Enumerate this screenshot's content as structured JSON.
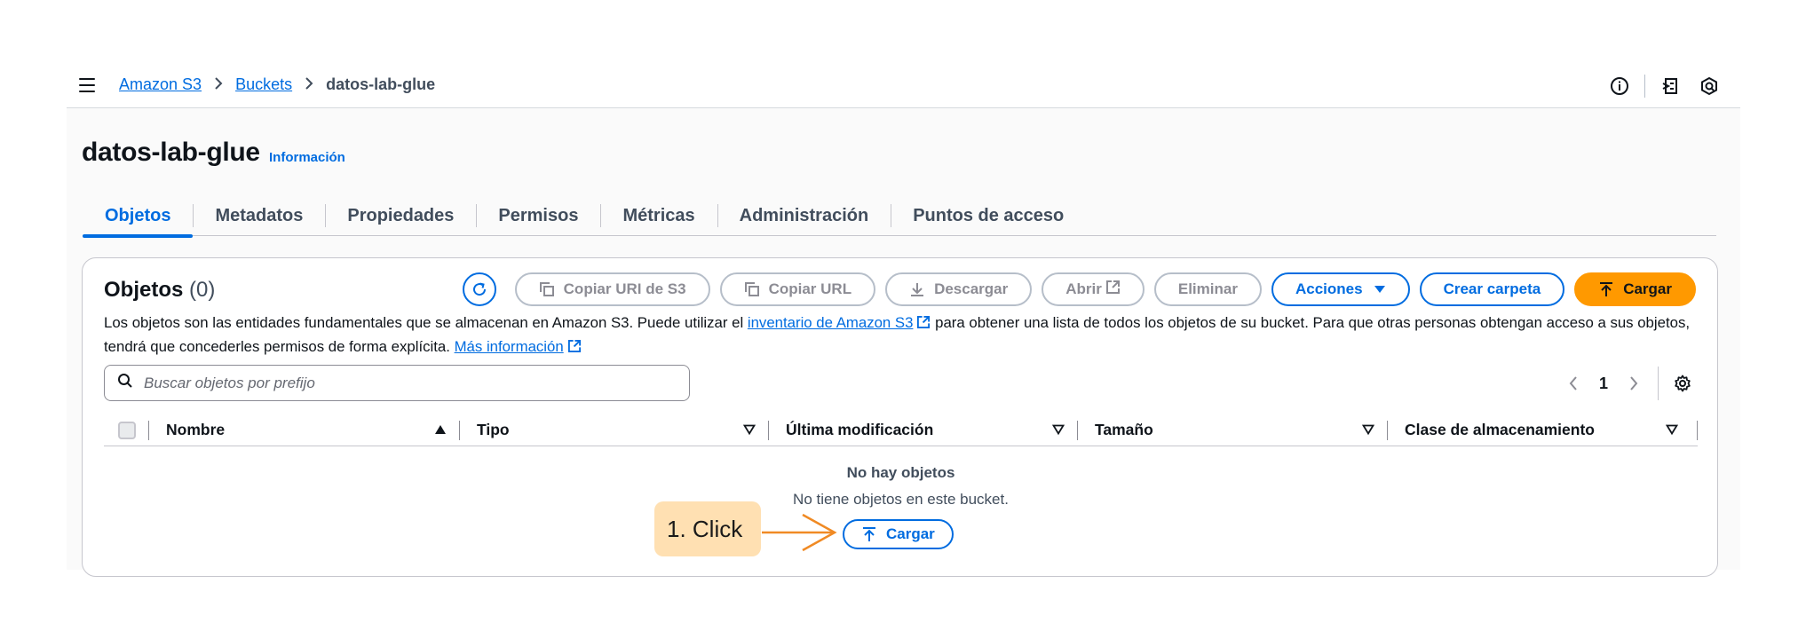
{
  "breadcrumb": {
    "items": [
      "Amazon S3",
      "Buckets"
    ],
    "separator": "›",
    "current": "datos-lab-glue"
  },
  "header": {
    "title": "datos-lab-glue",
    "info_link": "Información"
  },
  "tabs": [
    {
      "label": "Objetos",
      "active": true
    },
    {
      "label": "Metadatos"
    },
    {
      "label": "Propiedades"
    },
    {
      "label": "Permisos"
    },
    {
      "label": "Métricas"
    },
    {
      "label": "Administración"
    },
    {
      "label": "Puntos de acceso"
    }
  ],
  "panel": {
    "title": "Objetos",
    "count": "(0)",
    "buttons": {
      "copy_uri": "Copiar URI de S3",
      "copy_url": "Copiar URL",
      "download": "Descargar",
      "open": "Abrir",
      "delete": "Eliminar",
      "actions": "Acciones",
      "create_folder": "Crear carpeta",
      "upload": "Cargar"
    },
    "description": {
      "part1": "Los objetos son las entidades fundamentales que se almacenan en Amazon S3. Puede utilizar el ",
      "link1": "inventario de Amazon S3",
      "part2": " para obtener una lista de todos los objetos de su bucket. Para que otras personas obtengan acceso a sus objetos, tendrá que concederles permisos de forma explícita. ",
      "link2": "Más información"
    },
    "search": {
      "placeholder": "Buscar objetos por prefijo",
      "value": ""
    },
    "pagination": {
      "page": "1"
    },
    "columns": [
      "Nombre",
      "Tipo",
      "Última modificación",
      "Tamaño",
      "Clase de almacenamiento"
    ],
    "empty": {
      "title": "No hay objetos",
      "description": "No tiene objetos en este bucket.",
      "button": "Cargar"
    }
  },
  "annotation": {
    "label": "1. Click"
  },
  "colors": {
    "link": "#006ce0",
    "primary_button": "#ff9900",
    "callout": "#ffe0b2",
    "arrow": "#f08a24"
  }
}
